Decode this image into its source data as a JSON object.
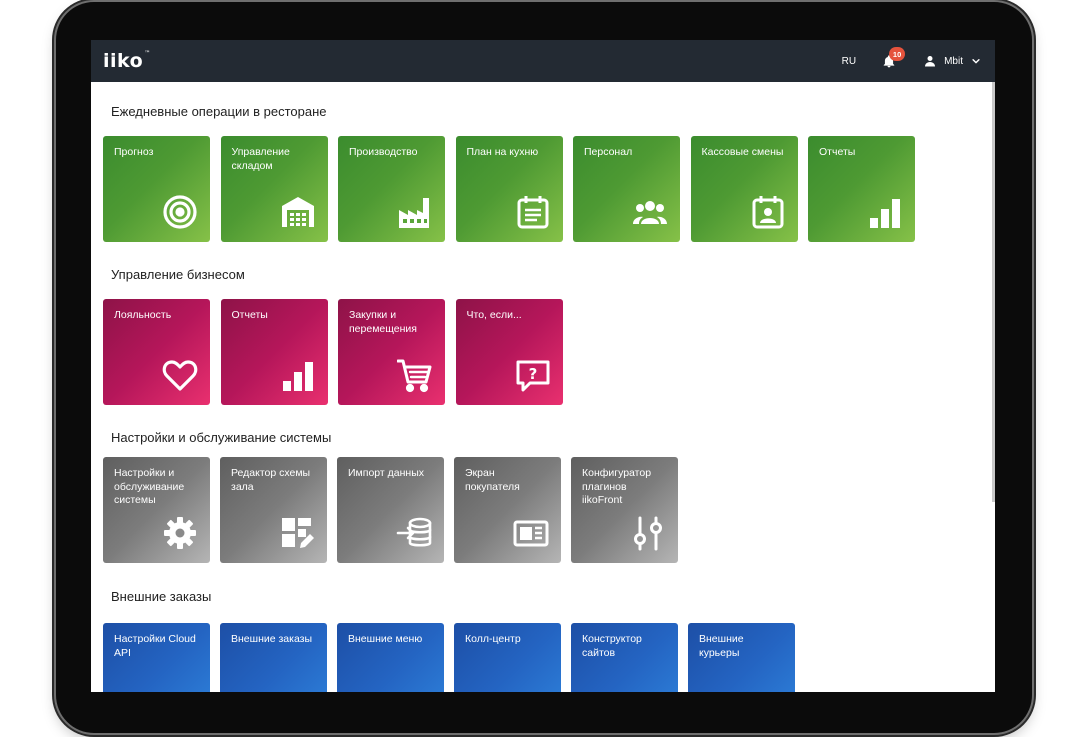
{
  "topbar": {
    "logo": "iiko",
    "logo_tm": "™",
    "lang": "RU",
    "notifications_count": "10",
    "user": "Mbit"
  },
  "colors": {
    "topbar": "#232a33",
    "green": "#4e9a33",
    "pink": "#b5165a",
    "gray": "#7c7c7c",
    "blue": "#2464c2",
    "badge": "#e5533d"
  },
  "sections": [
    {
      "title": "Ежедневные операции в ресторане",
      "tiles": [
        {
          "label": "Прогноз",
          "icon": "target-icon"
        },
        {
          "label": "Управление складом",
          "icon": "warehouse-icon"
        },
        {
          "label": "Производство",
          "icon": "factory-icon"
        },
        {
          "label": "План на кухню",
          "icon": "calendar-list-icon"
        },
        {
          "label": "Персонал",
          "icon": "people-icon"
        },
        {
          "label": "Кассовые смены",
          "icon": "calendar-user-icon"
        },
        {
          "label": "Отчеты",
          "icon": "bar-chart-icon"
        }
      ]
    },
    {
      "title": "Управление бизнесом",
      "tiles": [
        {
          "label": "Лояльность",
          "icon": "heart-icon"
        },
        {
          "label": "Отчеты",
          "icon": "bar-chart-icon"
        },
        {
          "label": "Закупки и перемещения",
          "icon": "cart-icon"
        },
        {
          "label": "Что, если...",
          "icon": "question-chat-icon"
        }
      ]
    },
    {
      "title": "Настройки и обслуживание системы",
      "tiles": [
        {
          "label": "Настройки и обслуживание системы",
          "icon": "gear-icon"
        },
        {
          "label": "Редактор схемы зала",
          "icon": "layout-edit-icon"
        },
        {
          "label": "Импорт данных",
          "icon": "database-import-icon"
        },
        {
          "label": "Экран покупателя",
          "icon": "customer-screen-icon"
        },
        {
          "label": "Конфигуратор плагинов iikoFront",
          "icon": "sliders-icon"
        }
      ]
    },
    {
      "title": "Внешние заказы",
      "tiles": [
        {
          "label": "Настройки Cloud API"
        },
        {
          "label": "Внешние заказы"
        },
        {
          "label": "Внешние меню"
        },
        {
          "label": "Колл-центр"
        },
        {
          "label": "Конструктор сайтов"
        },
        {
          "label": "Внешние курьеры"
        }
      ]
    }
  ]
}
